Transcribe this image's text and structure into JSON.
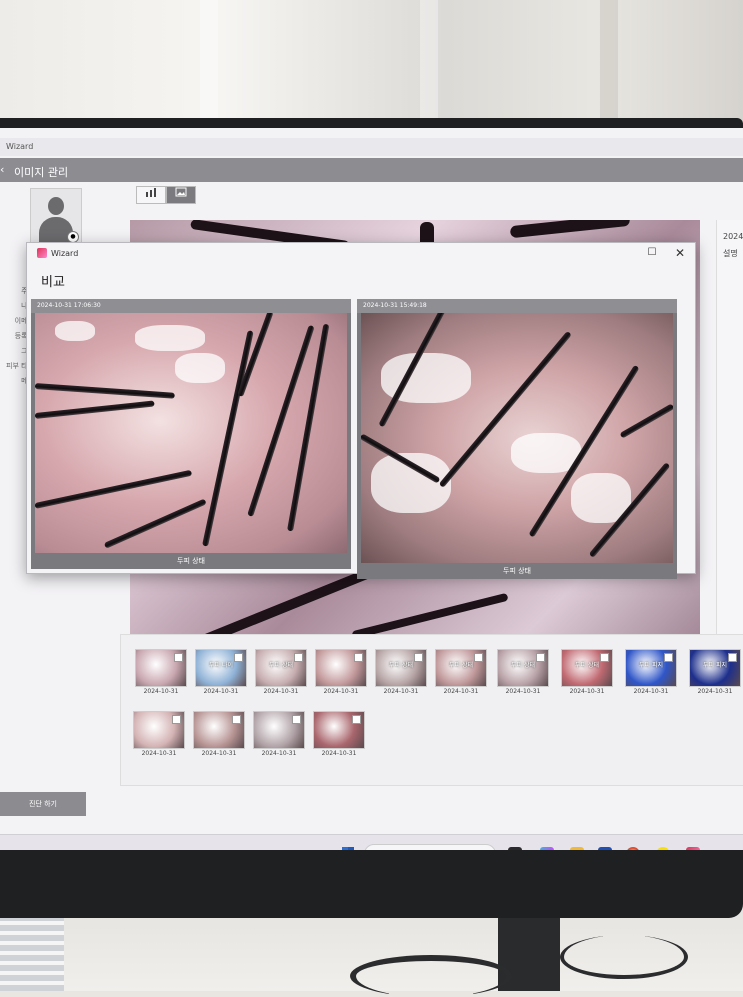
{
  "app": {
    "window_title": "Wizard",
    "page_title": "이미지 관리",
    "view_toggle": [
      "chart-icon",
      "image-icon"
    ]
  },
  "profile": {
    "fields": [
      "주별",
      "나이",
      "이메일",
      "등록일",
      "그룹",
      "피부 타입",
      "메모"
    ]
  },
  "right_panel": {
    "date": "2024-",
    "label": "설명"
  },
  "modal": {
    "app_name": "Wizard",
    "heading": "비교",
    "maximize_icon": "maximize-icon",
    "close_icon": "close-icon",
    "left": {
      "timestamp": "2024-10-31 17:06:30",
      "caption": "두피 상태"
    },
    "right": {
      "timestamp": "2024-10-31 15:49:18",
      "caption": "두피 상태"
    }
  },
  "thumbnails": [
    {
      "caption": "",
      "date": "2024-10-31",
      "color": "#c9a7b0"
    },
    {
      "caption": "두피 나이",
      "date": "2024-10-31",
      "color": "#8fb2d6"
    },
    {
      "caption": "두피 상태",
      "date": "2024-10-31",
      "color": "#c7aeb0"
    },
    {
      "caption": "",
      "date": "2024-10-31",
      "color": "#c39a9c"
    },
    {
      "caption": "두피 상태",
      "date": "2024-10-31",
      "color": "#b7a5a6"
    },
    {
      "caption": "두피 상태",
      "date": "2024-10-31",
      "color": "#c0989a"
    },
    {
      "caption": "두피 상태",
      "date": "2024-10-31",
      "color": "#b9a3a8"
    },
    {
      "caption": "두피 상태",
      "date": "2024-10-31",
      "color": "#c16a72"
    },
    {
      "caption": "두피 피지",
      "date": "2024-10-31",
      "color": "#2f56c8"
    },
    {
      "caption": "두피 피지",
      "date": "2024-10-31",
      "color": "#1d2f8c"
    },
    {
      "caption": "",
      "date": "2024-10-31",
      "color": "#d4b3b4"
    },
    {
      "caption": "",
      "date": "2024-10-31",
      "color": "#b89595"
    },
    {
      "caption": "",
      "date": "2024-10-31",
      "color": "#b2a4a8"
    },
    {
      "caption": "",
      "date": "2024-10-31",
      "color": "#a9666d"
    }
  ],
  "sidebar": {
    "diagnose_button": "진단 하기"
  },
  "taskbar": {
    "search_label": "검색",
    "apps": [
      "files-app",
      "copilot-app",
      "explorer-app",
      "store-app",
      "chrome-app",
      "kakaotalk-app",
      "wizard-app"
    ]
  }
}
